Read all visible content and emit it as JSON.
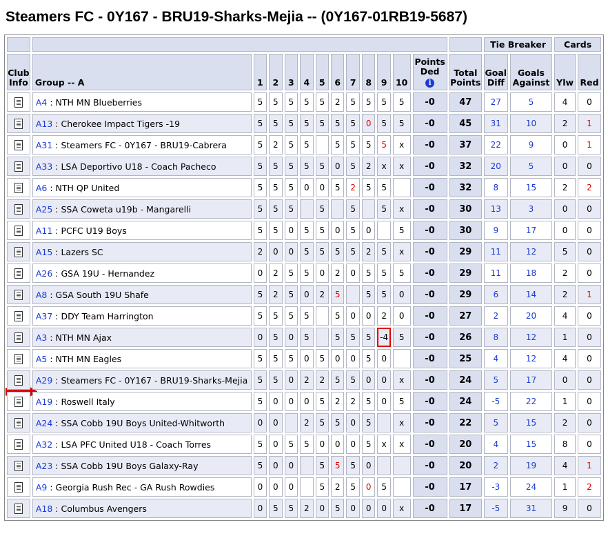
{
  "page": {
    "title": "Steamers FC - 0Y167 - BRU19-Sharks-Mejia -- (0Y167-01RB19-5687)"
  },
  "headers": {
    "tie_breaker": "Tie Breaker",
    "cards": "Cards",
    "club_info": "Club Info",
    "group": "Group -- A",
    "games": [
      "1",
      "2",
      "3",
      "4",
      "5",
      "6",
      "7",
      "8",
      "9",
      "10"
    ],
    "points_ded": "Points Ded",
    "total_points": "Total Points",
    "goal_diff": "Goal Diff",
    "goals_against": "Goals Against",
    "ylw": "Ylw",
    "red": "Red"
  },
  "icons": {
    "club_info": "document-icon",
    "points_info": "info-icon",
    "current_team": "red-arrow-icon"
  },
  "colors": {
    "header_bg": "#d9dfef",
    "link": "#1a3bd6",
    "alert": "#e00000",
    "row_alt": "#e8ebf5"
  },
  "rows": [
    {
      "code": "A4",
      "team": "NTH MN Blueberries",
      "scores": [
        "5",
        "5",
        "5",
        "5",
        "5",
        "2",
        "5",
        "5",
        "5",
        "5"
      ],
      "red_games": [],
      "boxed_games": [],
      "points_ded": "-0",
      "total": "47",
      "goal_diff": "27",
      "goals_against": "5",
      "ylw": "4",
      "red": "0",
      "red_card_alert": false,
      "current": false
    },
    {
      "code": "A13",
      "team": "Cherokee Impact Tigers -19",
      "scores": [
        "5",
        "5",
        "5",
        "5",
        "5",
        "5",
        "5",
        "0",
        "5",
        "5"
      ],
      "red_games": [
        7
      ],
      "boxed_games": [],
      "points_ded": "-0",
      "total": "45",
      "goal_diff": "31",
      "goals_against": "10",
      "ylw": "2",
      "red": "1",
      "red_card_alert": true,
      "current": false
    },
    {
      "code": "A31",
      "team": "Steamers FC - 0Y167 - BRU19-Cabrera",
      "scores": [
        "5",
        "2",
        "5",
        "5",
        "",
        "5",
        "5",
        "5",
        "5",
        "x"
      ],
      "red_games": [
        8
      ],
      "boxed_games": [],
      "points_ded": "-0",
      "total": "37",
      "goal_diff": "22",
      "goals_against": "9",
      "ylw": "0",
      "red": "1",
      "red_card_alert": true,
      "current": false
    },
    {
      "code": "A33",
      "team": "LSA Deportivo U18 - Coach Pacheco",
      "scores": [
        "5",
        "5",
        "5",
        "5",
        "5",
        "0",
        "5",
        "2",
        "x",
        "x"
      ],
      "red_games": [],
      "boxed_games": [],
      "points_ded": "-0",
      "total": "32",
      "goal_diff": "20",
      "goals_against": "5",
      "ylw": "0",
      "red": "0",
      "red_card_alert": false,
      "current": false
    },
    {
      "code": "A6",
      "team": "NTH QP United",
      "scores": [
        "5",
        "5",
        "5",
        "0",
        "0",
        "5",
        "2",
        "5",
        "5",
        ""
      ],
      "red_games": [
        6
      ],
      "boxed_games": [],
      "points_ded": "-0",
      "total": "32",
      "goal_diff": "8",
      "goals_against": "15",
      "ylw": "2",
      "red": "2",
      "red_card_alert": true,
      "current": false
    },
    {
      "code": "A25",
      "team": "SSA Coweta u19b - Mangarelli",
      "scores": [
        "5",
        "5",
        "5",
        "",
        "5",
        "",
        "5",
        "",
        "5",
        "x"
      ],
      "red_games": [],
      "boxed_games": [],
      "points_ded": "-0",
      "total": "30",
      "goal_diff": "13",
      "goals_against": "3",
      "ylw": "0",
      "red": "0",
      "red_card_alert": false,
      "current": false
    },
    {
      "code": "A11",
      "team": "PCFC U19 Boys",
      "scores": [
        "5",
        "5",
        "0",
        "5",
        "5",
        "0",
        "5",
        "0",
        "",
        "5"
      ],
      "red_games": [],
      "boxed_games": [],
      "points_ded": "-0",
      "total": "30",
      "goal_diff": "9",
      "goals_against": "17",
      "ylw": "0",
      "red": "0",
      "red_card_alert": false,
      "current": false
    },
    {
      "code": "A15",
      "team": "Lazers SC",
      "scores": [
        "2",
        "0",
        "0",
        "5",
        "5",
        "5",
        "5",
        "2",
        "5",
        "x"
      ],
      "red_games": [],
      "boxed_games": [],
      "points_ded": "-0",
      "total": "29",
      "goal_diff": "11",
      "goals_against": "12",
      "ylw": "5",
      "red": "0",
      "red_card_alert": false,
      "current": false
    },
    {
      "code": "A26",
      "team": "GSA 19U - Hernandez",
      "scores": [
        "0",
        "2",
        "5",
        "5",
        "0",
        "2",
        "0",
        "5",
        "5",
        "5"
      ],
      "red_games": [],
      "boxed_games": [],
      "points_ded": "-0",
      "total": "29",
      "goal_diff": "11",
      "goals_against": "18",
      "ylw": "2",
      "red": "0",
      "red_card_alert": false,
      "current": false
    },
    {
      "code": "A8",
      "team": "GSA South 19U Shafe",
      "scores": [
        "5",
        "2",
        "5",
        "0",
        "2",
        "5",
        "",
        "5",
        "5",
        "0"
      ],
      "red_games": [
        5
      ],
      "boxed_games": [],
      "points_ded": "-0",
      "total": "29",
      "goal_diff": "6",
      "goals_against": "14",
      "ylw": "2",
      "red": "1",
      "red_card_alert": true,
      "current": false
    },
    {
      "code": "A37",
      "team": "DDY Team Harrington",
      "scores": [
        "5",
        "5",
        "5",
        "5",
        "",
        "5",
        "0",
        "0",
        "2",
        "0"
      ],
      "red_games": [],
      "boxed_games": [],
      "points_ded": "-0",
      "total": "27",
      "goal_diff": "2",
      "goals_against": "20",
      "ylw": "4",
      "red": "0",
      "red_card_alert": false,
      "current": false
    },
    {
      "code": "A3",
      "team": "NTH MN Ajax",
      "scores": [
        "0",
        "5",
        "0",
        "5",
        "",
        "5",
        "5",
        "5",
        "-4",
        "5"
      ],
      "red_games": [],
      "boxed_games": [
        8
      ],
      "points_ded": "-0",
      "total": "26",
      "goal_diff": "8",
      "goals_against": "12",
      "ylw": "1",
      "red": "0",
      "red_card_alert": false,
      "current": false
    },
    {
      "code": "A5",
      "team": "NTH MN Eagles",
      "scores": [
        "5",
        "5",
        "5",
        "0",
        "5",
        "0",
        "0",
        "5",
        "0",
        ""
      ],
      "red_games": [],
      "boxed_games": [],
      "points_ded": "-0",
      "total": "25",
      "goal_diff": "4",
      "goals_against": "12",
      "ylw": "4",
      "red": "0",
      "red_card_alert": false,
      "current": false
    },
    {
      "code": "A29",
      "team": "Steamers FC - 0Y167 - BRU19-Sharks-Mejia",
      "scores": [
        "5",
        "5",
        "0",
        "2",
        "2",
        "5",
        "5",
        "0",
        "0",
        "x"
      ],
      "red_games": [],
      "boxed_games": [],
      "points_ded": "-0",
      "total": "24",
      "goal_diff": "5",
      "goals_against": "17",
      "ylw": "0",
      "red": "0",
      "red_card_alert": false,
      "current": true
    },
    {
      "code": "A19",
      "team": "Roswell Italy",
      "scores": [
        "5",
        "0",
        "0",
        "0",
        "5",
        "2",
        "2",
        "5",
        "0",
        "5"
      ],
      "red_games": [],
      "boxed_games": [],
      "points_ded": "-0",
      "total": "24",
      "goal_diff": "-5",
      "goals_against": "22",
      "ylw": "1",
      "red": "0",
      "red_card_alert": false,
      "current": false
    },
    {
      "code": "A24",
      "team": "SSA Cobb 19U Boys United-Whitworth",
      "scores": [
        "0",
        "0",
        "",
        "2",
        "5",
        "5",
        "0",
        "5",
        "",
        "x"
      ],
      "red_games": [],
      "boxed_games": [],
      "points_ded": "-0",
      "total": "22",
      "goal_diff": "5",
      "goals_against": "15",
      "ylw": "2",
      "red": "0",
      "red_card_alert": false,
      "current": false
    },
    {
      "code": "A32",
      "team": "LSA PFC United U18 - Coach Torres",
      "scores": [
        "5",
        "0",
        "5",
        "5",
        "0",
        "0",
        "0",
        "5",
        "x",
        "x"
      ],
      "red_games": [],
      "boxed_games": [],
      "points_ded": "-0",
      "total": "20",
      "goal_diff": "4",
      "goals_against": "15",
      "ylw": "8",
      "red": "0",
      "red_card_alert": false,
      "current": false
    },
    {
      "code": "A23",
      "team": "SSA Cobb 19U Boys Galaxy-Ray",
      "scores": [
        "5",
        "0",
        "0",
        "",
        "5",
        "5",
        "5",
        "0",
        "",
        ""
      ],
      "red_games": [
        5
      ],
      "boxed_games": [],
      "points_ded": "-0",
      "total": "20",
      "goal_diff": "2",
      "goals_against": "19",
      "ylw": "4",
      "red": "1",
      "red_card_alert": true,
      "current": false
    },
    {
      "code": "A9",
      "team": "Georgia Rush Rec - GA Rush Rowdies",
      "scores": [
        "0",
        "0",
        "0",
        "",
        "5",
        "2",
        "5",
        "0",
        "5",
        ""
      ],
      "red_games": [
        7
      ],
      "boxed_games": [],
      "points_ded": "-0",
      "total": "17",
      "goal_diff": "-3",
      "goals_against": "24",
      "ylw": "1",
      "red": "2",
      "red_card_alert": true,
      "current": false
    },
    {
      "code": "A18",
      "team": "Columbus Avengers",
      "scores": [
        "0",
        "5",
        "5",
        "2",
        "0",
        "5",
        "0",
        "0",
        "0",
        "x"
      ],
      "red_games": [],
      "boxed_games": [],
      "points_ded": "-0",
      "total": "17",
      "goal_diff": "-5",
      "goals_against": "31",
      "ylw": "9",
      "red": "0",
      "red_card_alert": false,
      "current": false
    }
  ]
}
